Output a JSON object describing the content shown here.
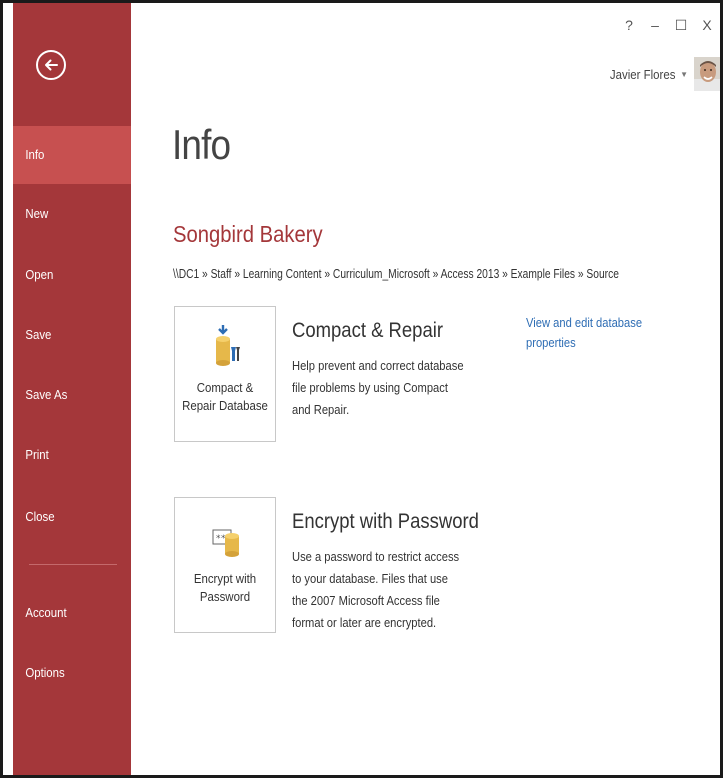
{
  "window": {
    "controls": {
      "help": "?",
      "minimize": "–",
      "maximize": "☐",
      "close": "X"
    },
    "user": {
      "name": "Javier Flores",
      "caret": "▼"
    }
  },
  "sidebar": {
    "back_icon": "back-arrow-icon",
    "items": [
      {
        "label": "Info",
        "active": true
      },
      {
        "label": "New"
      },
      {
        "label": "Open"
      },
      {
        "label": "Save"
      },
      {
        "label": "Save As"
      },
      {
        "label": "Print"
      },
      {
        "label": "Close"
      },
      {
        "label": "Account"
      },
      {
        "label": "Options"
      }
    ]
  },
  "main": {
    "title": "Info",
    "database_name": "Songbird Bakery",
    "path": "\\\\DC1 » Staff » Learning Content » Curriculum_Microsoft » Access 2013 » Example Files » Source",
    "properties_link": "View and edit database properties",
    "sections": [
      {
        "button_label": "Compact &\nRepair Database",
        "icon": "compact-repair-icon",
        "heading": "Compact & Repair",
        "description": "Help prevent and correct database file problems by using Compact and Repair."
      },
      {
        "button_label": "Encrypt with\nPassword",
        "icon": "encrypt-password-icon",
        "heading": "Encrypt with Password",
        "description": "Use a password to restrict access to your database. Files that use the 2007 Microsoft Access file format or later are encrypted."
      }
    ]
  },
  "colors": {
    "sidebar": "#a4373a",
    "sidebar_active": "#c75050",
    "accent_text": "#a4373a",
    "link": "#2e6db4"
  }
}
